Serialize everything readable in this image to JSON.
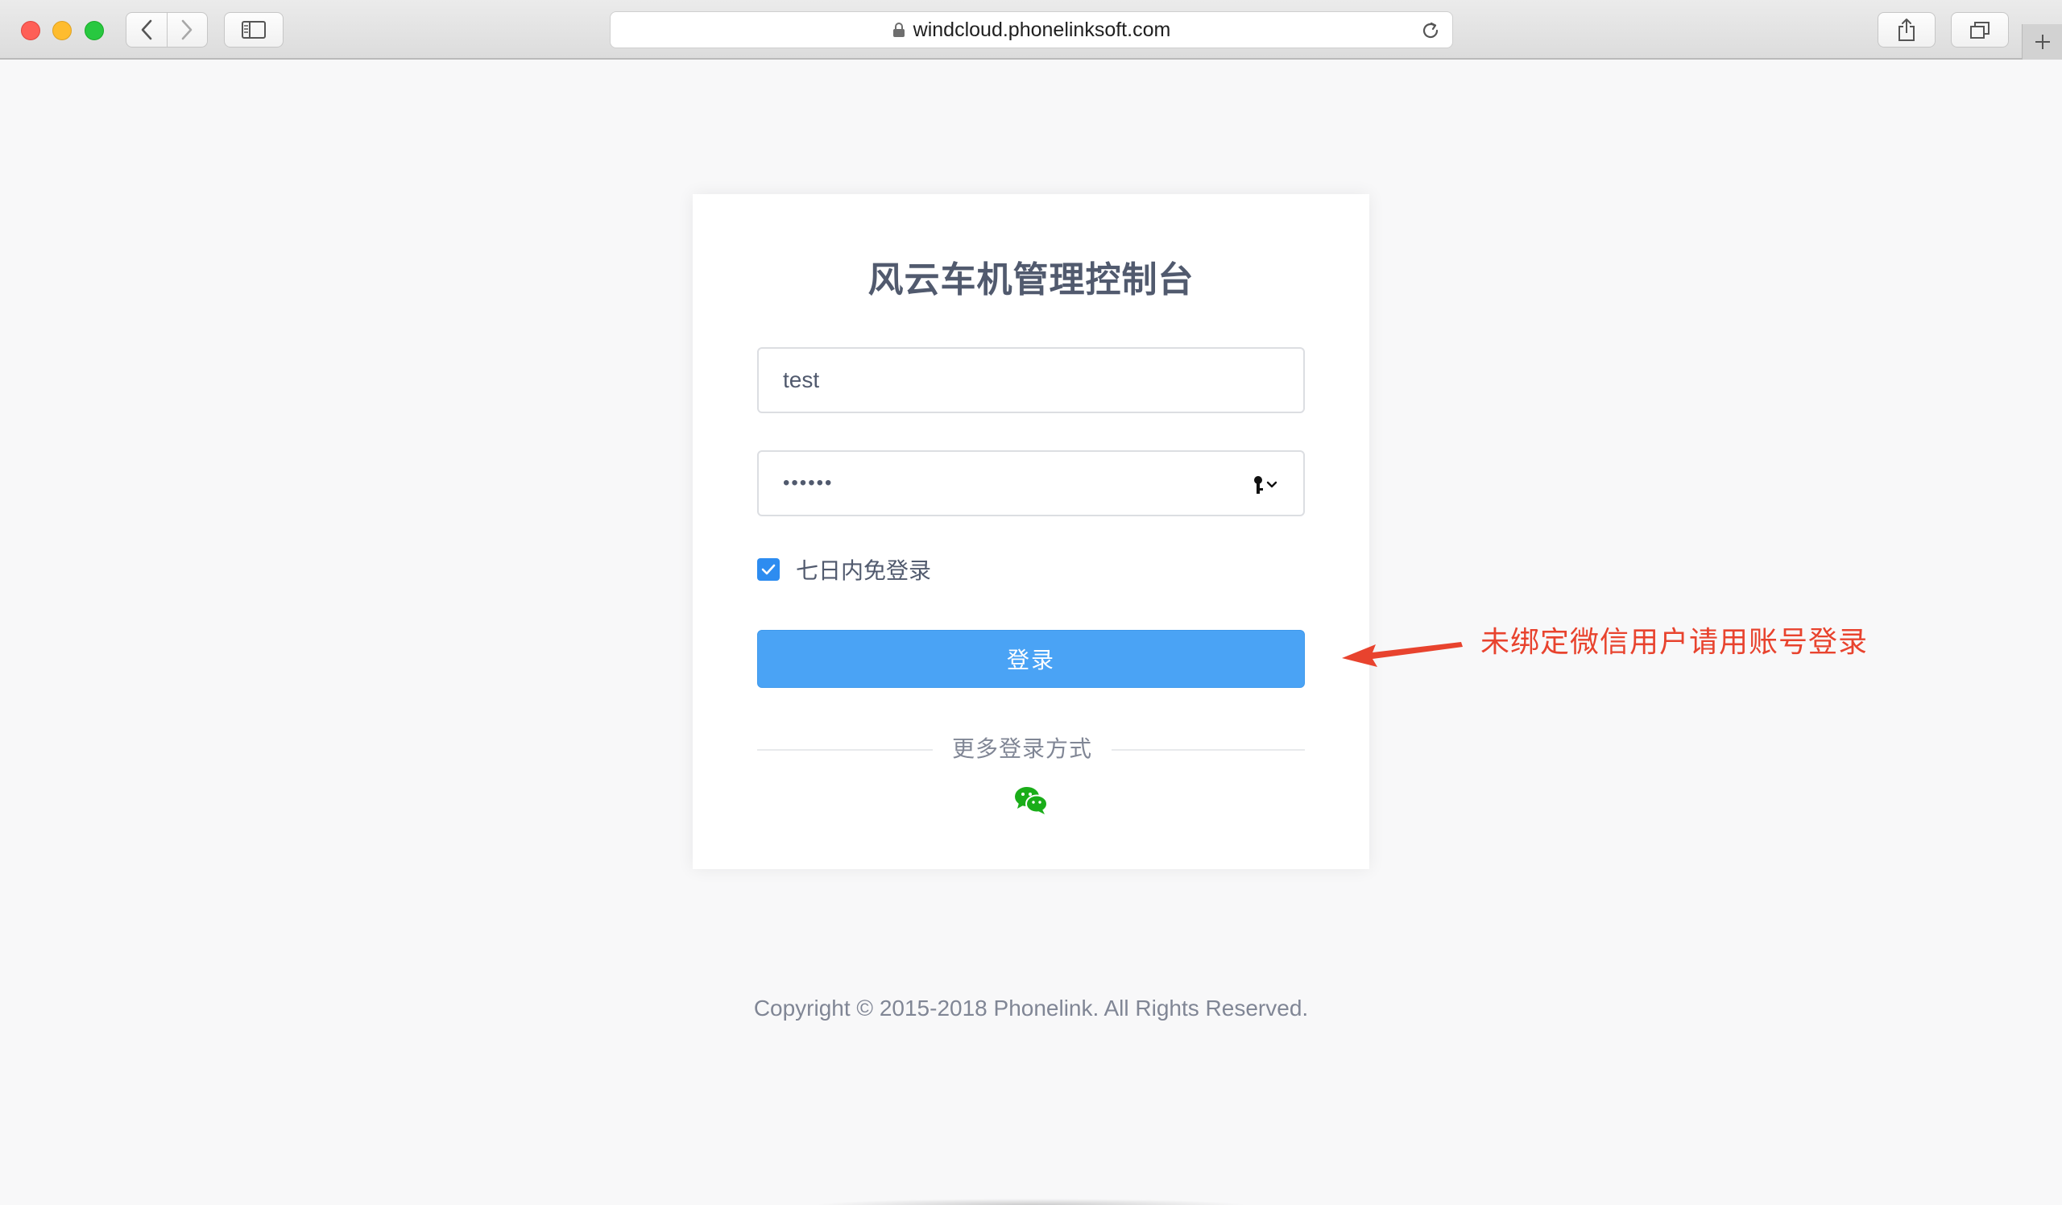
{
  "browser": {
    "url": "windcloud.phonelinksoft.com"
  },
  "login": {
    "title": "风云车机管理控制台",
    "username_value": "test",
    "password_mask": "••••••",
    "remember_label": "七日内免登录",
    "remember_checked": true,
    "login_button": "登录",
    "more_login": "更多登录方式"
  },
  "annotation": {
    "text": "未绑定微信用户请用账号登录",
    "color": "#e8432e"
  },
  "footer": {
    "copyright": "Copyright © 2015-2018 Phonelink. All Rights Reserved."
  },
  "colors": {
    "primary": "#4aa3f5",
    "checkbox": "#2d8cf0",
    "wechat": "#1aad19"
  },
  "icons": [
    "lock-icon",
    "reload-icon",
    "back-icon",
    "forward-icon",
    "sidebar-icon",
    "share-icon",
    "tabs-icon",
    "plus-icon",
    "key-icon",
    "check-icon",
    "wechat-icon",
    "arrow-icon"
  ]
}
